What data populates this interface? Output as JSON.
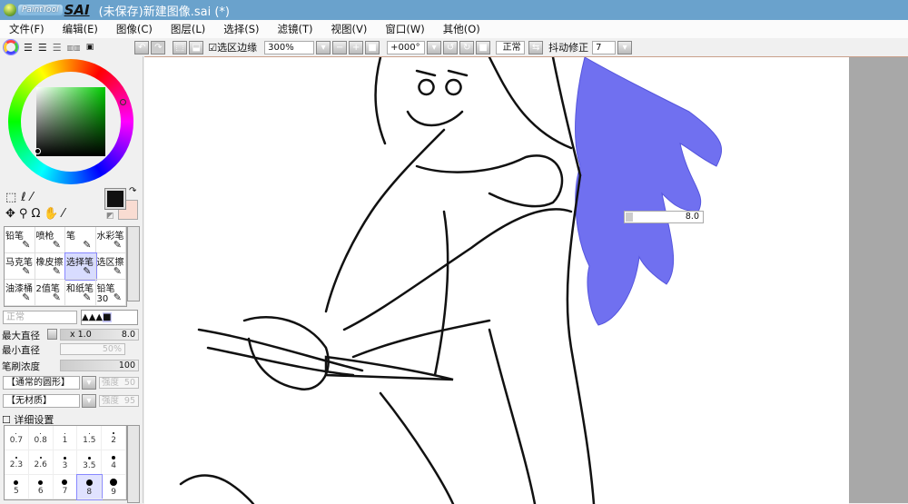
{
  "title": {
    "logo": "PaintTool SAI",
    "text": "(未保存)新建图像.sai (*)"
  },
  "menu": [
    "文件(F)",
    "编辑(E)",
    "图像(C)",
    "图层(L)",
    "选择(S)",
    "滤镜(T)",
    "视图(V)",
    "窗口(W)",
    "其他(O)"
  ],
  "toolbar": {
    "selection_edge": "选区边缘",
    "zoom": "300%",
    "angle": "+000°",
    "blend": "正常",
    "stabilizer_label": "抖动修正",
    "stabilizer": "7"
  },
  "colors": {
    "primary": "#111111",
    "secondary": "#f9dcd2",
    "accent": "#7777ee"
  },
  "tools": [
    {
      "label": "铅笔",
      "icon": "pencil-icon"
    },
    {
      "label": "喷枪",
      "icon": "airbrush-icon"
    },
    {
      "label": "笔",
      "icon": "pen-icon"
    },
    {
      "label": "水彩笔",
      "icon": "watercolor-icon"
    },
    {
      "label": "马克笔",
      "icon": "marker-icon"
    },
    {
      "label": "橡皮擦",
      "icon": "eraser-icon"
    },
    {
      "label": "选择笔",
      "icon": "select-pen-icon",
      "selected": true
    },
    {
      "label": "选区擦",
      "icon": "select-eraser-icon"
    },
    {
      "label": "油漆桶",
      "icon": "bucket-icon"
    },
    {
      "label": "2值笔",
      "icon": "binary-pen-icon"
    },
    {
      "label": "和纸笔",
      "icon": "washi-pen-icon"
    },
    {
      "label": "铅笔30",
      "icon": "pencil30-icon"
    }
  ],
  "brush": {
    "mode": "正常",
    "max_size_label": "最大直径",
    "max_mult": "x 1.0",
    "max_size": "8.0",
    "min_size_label": "最小直径",
    "min_size": "50%",
    "density_label": "笔刷浓度",
    "density": "100",
    "shape": "【通常的圆形】",
    "shape_strength_label": "强度",
    "shape_strength": "50",
    "texture": "【无材质】",
    "texture_strength_label": "强度",
    "texture_strength": "95",
    "advanced": "详细设置"
  },
  "sizes": [
    "0.7",
    "0.8",
    "1",
    "1.5",
    "2",
    "2.3",
    "2.6",
    "3",
    "3.5",
    "4",
    "5",
    "6",
    "7",
    "8",
    "9"
  ],
  "selected_size": "8",
  "size_tooltip": "8.0"
}
